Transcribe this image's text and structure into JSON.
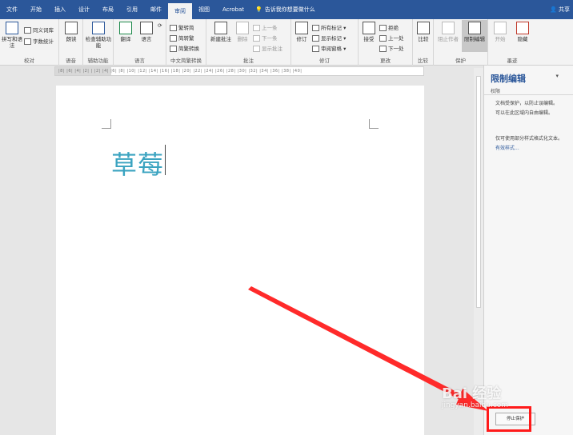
{
  "tabs": [
    "文件",
    "开始",
    "插入",
    "设计",
    "布局",
    "引用",
    "邮件",
    "审阅",
    "视图",
    "Acrobat"
  ],
  "active_tab_index": 7,
  "tell_me": "告诉我你想要做什么",
  "share": "共享",
  "ribbon": {
    "proofing": {
      "label": "校对",
      "spell": "拼写和语法",
      "thesaurus": "同义词库",
      "wordcount": "字数统计"
    },
    "speech": {
      "label": "语音",
      "read_aloud": "朗读"
    },
    "accessibility": {
      "label": "辅助功能",
      "check": "检查辅助功能"
    },
    "language": {
      "label": "语言",
      "translate": "翻译",
      "language": "语言"
    },
    "chinese": {
      "label": "中文简繁转换",
      "to_simplified": "繁转简",
      "to_traditional": "简转繁",
      "convert": "简繁转换"
    },
    "comments": {
      "label": "批注",
      "new": "新建批注",
      "delete": "删除",
      "prev": "上一条",
      "next": "下一条",
      "show": "显示批注"
    },
    "tracking": {
      "label": "修订",
      "track": "修订",
      "markup": "所有标记",
      "show_markup": "显示标记",
      "pane": "审阅窗格"
    },
    "changes": {
      "label": "更改",
      "accept": "接受",
      "reject": "拒绝",
      "prev": "上一处",
      "next": "下一处"
    },
    "compare": {
      "label": "比较",
      "compare": "比较"
    },
    "protect": {
      "label": "保护",
      "block": "阻止作者",
      "restrict": "限制编辑"
    },
    "ink": {
      "label": "墨迹",
      "start": "开始",
      "hide": "隐藏"
    }
  },
  "ruler_text": "|8| |6| |4| |2| | |2| |4| |6| |8| |10| |12| |14| |16| |18| |20| |22| |24| |26| |28| |30| |32| |34| |36| |38| |40|",
  "document": {
    "text": "草莓"
  },
  "pane": {
    "title": "限制编辑",
    "subtitle": "权限",
    "line1": "文档受保护，以防止误编辑。",
    "line2": "可以在此区域内自由编辑。",
    "line3": "仅可使用部分样式格式化文本。",
    "link": "有效样式...",
    "stop_button": "停止保护"
  },
  "watermark": {
    "main": "Bai 经验",
    "sub": "jingyan.baidu.com"
  },
  "colors": {
    "ribbon_blue": "#2b579a",
    "doc_text": "#3aa3c0",
    "highlight": "#ff1a1a"
  }
}
